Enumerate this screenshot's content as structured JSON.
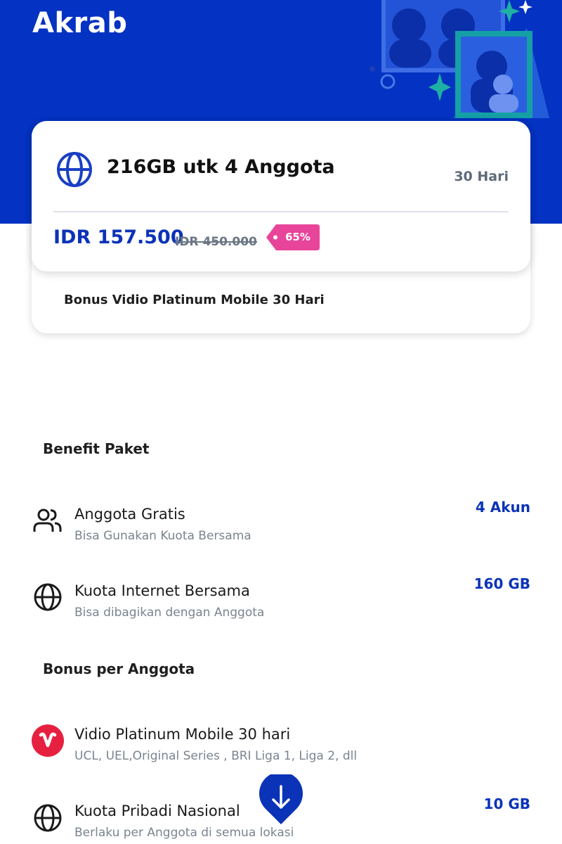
{
  "header": {
    "title": "Akrab",
    "background_color": "#0432c2"
  },
  "package": {
    "icon": "globe-icon",
    "name": "216GB utk 4 Anggota",
    "duration": "30 Hari",
    "price": "IDR 157.500",
    "old_price": "IDR 450.000",
    "discount": "65%",
    "discount_color": "#e8449a",
    "bonus": "Bonus Vidio Platinum Mobile 30 Hari"
  },
  "benefit": {
    "title": "Benefit Paket",
    "items": [
      {
        "icon": "people-icon",
        "title": "Anggota Gratis",
        "subtitle": "Bisa Gunakan Kuota Bersama",
        "value": "4 Akun"
      },
      {
        "icon": "globe-icon",
        "title": "Kuota Internet Bersama",
        "subtitle": "Bisa dibagikan dengan Anggota",
        "value": "160 GB"
      }
    ]
  },
  "bonus_member": {
    "title": "Bonus per Anggota",
    "items": [
      {
        "icon": "vidio-logo-icon",
        "title": "Vidio Platinum Mobile 30 hari",
        "subtitle": "UCL, UEL,Original Series , BRI Liga 1, Liga 2, dll",
        "value": ""
      },
      {
        "icon": "globe-icon",
        "title": "Kuota Pribadi Nasional",
        "subtitle": "Berlaku per Anggota di semua lokasi",
        "value": "10 GB"
      }
    ]
  },
  "scroll_button": {
    "icon": "arrow-down-icon"
  }
}
